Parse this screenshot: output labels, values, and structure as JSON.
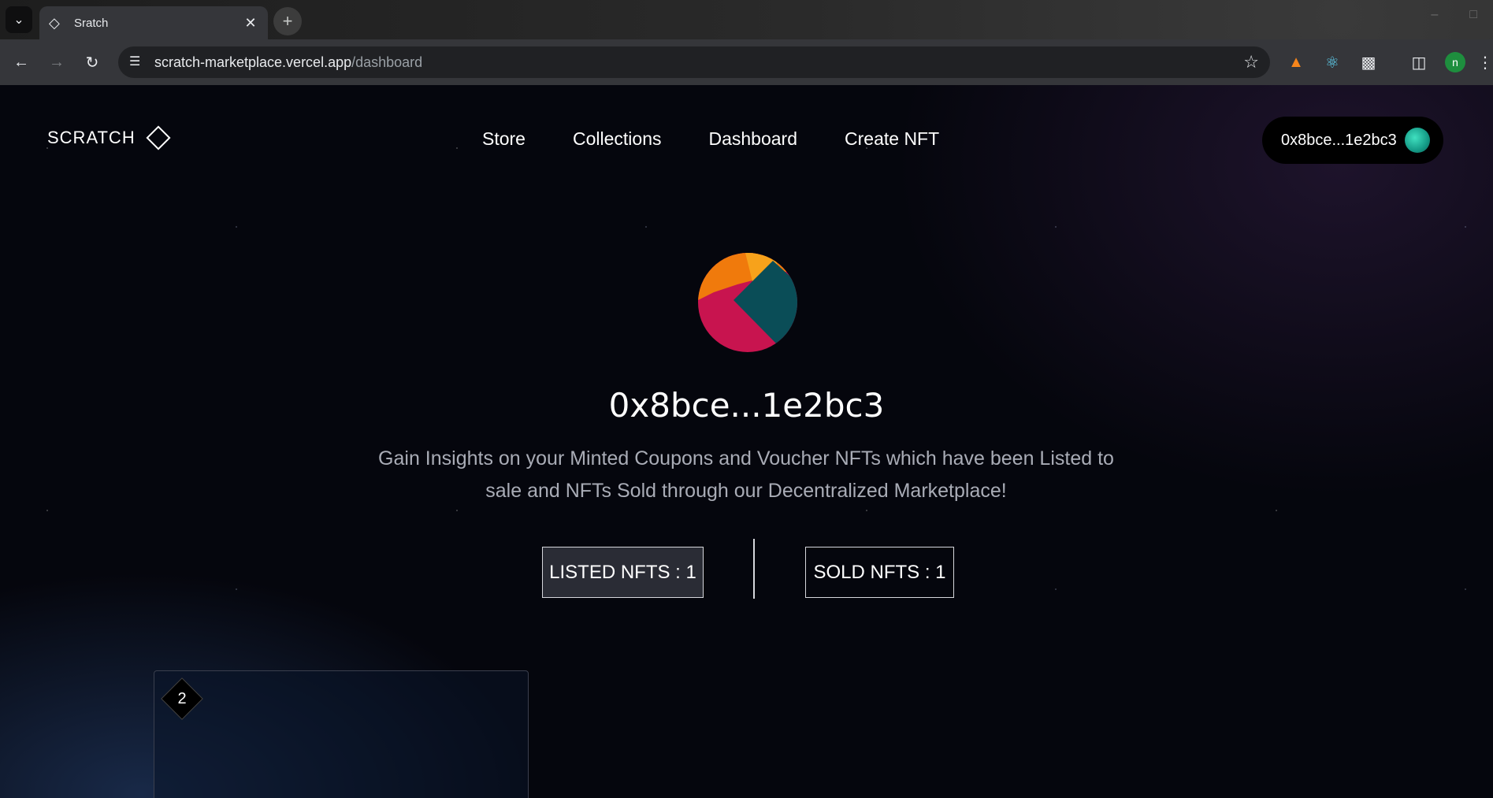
{
  "browser": {
    "tab_title": "Sratch",
    "url_host": "scratch-marketplace.vercel.app",
    "url_path": "/dashboard",
    "profile_initial": "n"
  },
  "site": {
    "logo_text": "SCRATCH",
    "nav": [
      "Store",
      "Collections",
      "Dashboard",
      "Create NFT"
    ],
    "wallet_address": "0x8bce...1e2bc3"
  },
  "profile": {
    "address": "0x8bce...1e2bc3",
    "description": "Gain Insights on your Minted Coupons and Voucher NFTs which have been Listed to sale and NFTs Sold through our Decentralized Marketplace!"
  },
  "stats": {
    "listed_label": "LISTED NFTS : 1",
    "sold_label": "SOLD NFTS : 1"
  },
  "cards": [
    {
      "badge": "2"
    }
  ],
  "colors": {
    "accent": "#2a2c35",
    "avatar_pink": "#c8144f",
    "avatar_teal": "#0a4d57",
    "avatar_orange": "#f07a0c"
  }
}
